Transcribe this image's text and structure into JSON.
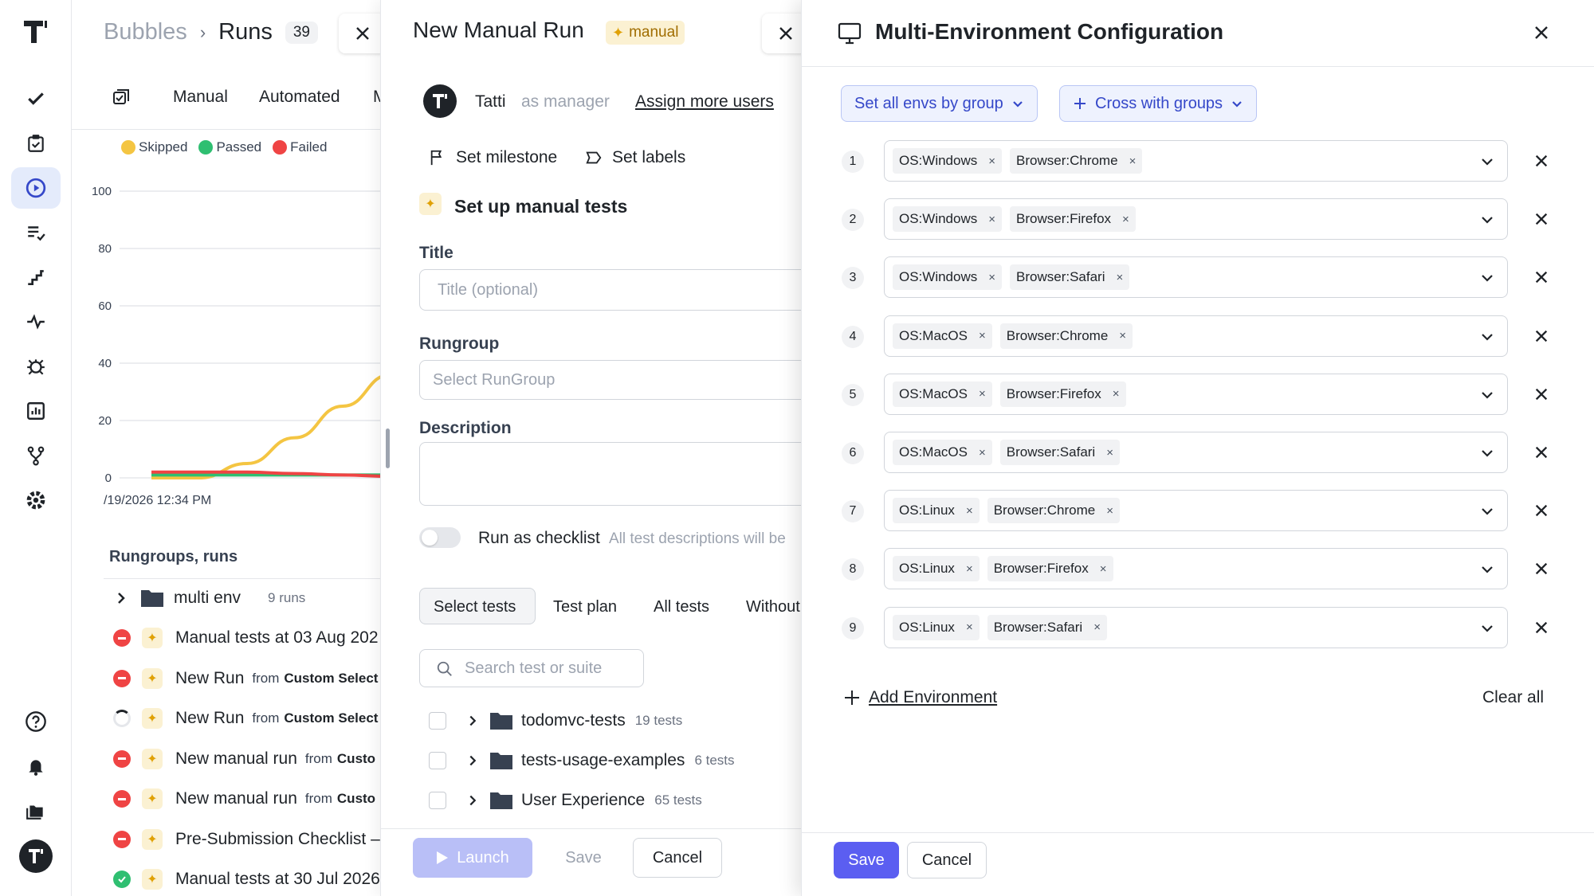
{
  "runs_panel": {
    "breadcrumb_project": "Bubbles",
    "breadcrumb_separator": "›",
    "breadcrumb_page": "Runs",
    "runs_count": "39",
    "tabs": [
      "Manual",
      "Automated",
      "M"
    ],
    "legend": [
      {
        "label": "Skipped",
        "color": "#f4c542"
      },
      {
        "label": "Passed",
        "color": "#2fbf71"
      },
      {
        "label": "Failed",
        "color": "#ef4444"
      }
    ],
    "chart_date_label": "/19/2026 12:34 PM",
    "section_title": "Rungroups, runs",
    "group": {
      "name": "multi env",
      "count": "9 runs"
    },
    "items": [
      {
        "status": "failed",
        "title": "Manual tests at 03 Aug 202",
        "from": "",
        "from_bold": ""
      },
      {
        "status": "failed",
        "title": "New Run",
        "from": "from",
        "from_bold": "Custom Select"
      },
      {
        "status": "running",
        "title": "New Run",
        "from": "from",
        "from_bold": "Custom Select"
      },
      {
        "status": "failed",
        "title": "New manual run",
        "from": "from",
        "from_bold": "Custo"
      },
      {
        "status": "failed",
        "title": "New manual run",
        "from": "from",
        "from_bold": "Custo"
      },
      {
        "status": "failed",
        "title": "Pre-Submission Checklist –",
        "from": "",
        "from_bold": ""
      },
      {
        "status": "passed",
        "title": "Manual tests at 30 Jul 2026",
        "from": "",
        "from_bold": ""
      }
    ]
  },
  "chart_data": {
    "type": "line",
    "title": "",
    "xlabel": "",
    "ylabel": "",
    "ylim": [
      0,
      100
    ],
    "yticks": [
      0,
      20,
      40,
      60,
      80,
      100
    ],
    "x_label_visible": "/19/2026 12:34 PM",
    "series": [
      {
        "name": "Skipped",
        "color": "#f4c542",
        "values": [
          0,
          0,
          5,
          14,
          25,
          36
        ]
      },
      {
        "name": "Passed",
        "color": "#2fbf71",
        "values": [
          1,
          1,
          1,
          1,
          1,
          1
        ]
      },
      {
        "name": "Failed",
        "color": "#ef4444",
        "values": [
          2,
          2,
          2,
          1.5,
          1,
          0.5
        ]
      }
    ],
    "grid": true,
    "legend_position": "top"
  },
  "manual_panel": {
    "title": "New Manual Run",
    "badge": "manual",
    "user_name": "Tatti",
    "user_role": "as manager",
    "assign_link": "Assign more users",
    "set_milestone": "Set milestone",
    "set_labels": "Set labels",
    "setup_title": "Set up manual tests",
    "title_label": "Title",
    "title_placeholder": "Title (optional)",
    "rungroup_label": "Rungroup",
    "rungroup_placeholder": "Select RunGroup",
    "description_label": "Description",
    "checklist_label": "Run as checklist",
    "checklist_hint": "All test descriptions will be",
    "tabs": [
      "Select tests",
      "Test plan",
      "All tests",
      "Without"
    ],
    "search_placeholder": "Search test or suite",
    "tree": [
      {
        "name": "todomvc-tests",
        "count": "19 tests"
      },
      {
        "name": "tests-usage-examples",
        "count": "6 tests"
      },
      {
        "name": "User Experience",
        "count": "65 tests"
      }
    ],
    "launch": "Launch",
    "save": "Save",
    "cancel": "Cancel"
  },
  "env_panel": {
    "title": "Multi-Environment Configuration",
    "set_all_btn": "Set all envs by group",
    "cross_btn": "Cross with groups",
    "rows": [
      {
        "num": "1",
        "tags": [
          "OS:Windows",
          "Browser:Chrome"
        ]
      },
      {
        "num": "2",
        "tags": [
          "OS:Windows",
          "Browser:Firefox"
        ]
      },
      {
        "num": "3",
        "tags": [
          "OS:Windows",
          "Browser:Safari"
        ]
      },
      {
        "num": "4",
        "tags": [
          "OS:MacOS",
          "Browser:Chrome"
        ]
      },
      {
        "num": "5",
        "tags": [
          "OS:MacOS",
          "Browser:Firefox"
        ]
      },
      {
        "num": "6",
        "tags": [
          "OS:MacOS",
          "Browser:Safari"
        ]
      },
      {
        "num": "7",
        "tags": [
          "OS:Linux",
          "Browser:Chrome"
        ]
      },
      {
        "num": "8",
        "tags": [
          "OS:Linux",
          "Browser:Firefox"
        ]
      },
      {
        "num": "9",
        "tags": [
          "OS:Linux",
          "Browser:Safari"
        ]
      }
    ],
    "tag_remove": "×",
    "add_env": "Add Environment",
    "clear_all": "Clear all",
    "save": "Save",
    "cancel": "Cancel",
    "accent": "#5b5ef1"
  }
}
